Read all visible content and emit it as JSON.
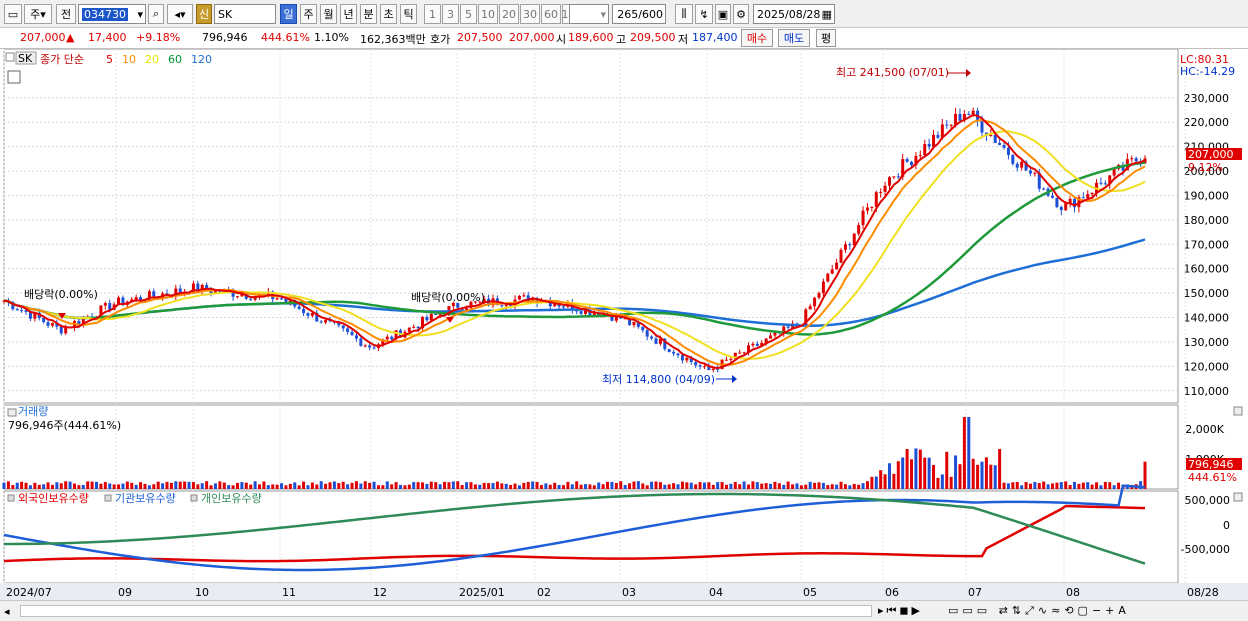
{
  "toolbar": {
    "period_label": "주",
    "prev_label": "전",
    "code": "034730",
    "credit_badge": "신",
    "stock_name": "SK",
    "tabs": [
      "일",
      "주",
      "월",
      "년",
      "분",
      "초",
      "틱"
    ],
    "intervals": [
      "1",
      "3",
      "5",
      "10",
      "20",
      "30",
      "60",
      "120"
    ],
    "count": "265",
    "count_total": "/600",
    "date": "2025/08/28"
  },
  "info": {
    "price": "207,000",
    "change": "17,400",
    "change_pct": "+9.18%",
    "volume": "796,946",
    "volume_pct": "444.61%",
    "turnover": "1.10%",
    "amount": "162,363백만",
    "quote_label": "호가",
    "ask": "207,500",
    "bid": "207,000",
    "open_label": "시",
    "open": "189,600",
    "high_label": "고",
    "high": "209,500",
    "low_label": "저",
    "low": "187,400",
    "buy_button": "매수",
    "sell_button": "매도",
    "extra_button": "평"
  },
  "legend": {
    "name": "SK",
    "ma_label": "종가 단순",
    "ma": [
      {
        "label": "5",
        "color": "#e00000"
      },
      {
        "label": "10",
        "color": "#ff8c00"
      },
      {
        "label": "20",
        "color": "#e6e600"
      },
      {
        "label": "60",
        "color": "#009933"
      },
      {
        "label": "120",
        "color": "#1e6ed8"
      }
    ]
  },
  "annotations": {
    "high": "최고 241,500 (07/01)",
    "low": "최저 114,800 (04/09)",
    "dividend": "배당락(0.00%)"
  },
  "lc_hc": [
    "LC:80.31",
    "HC:-14.29"
  ],
  "price_badge": "207,000",
  "price_badge_pct": "9.12%",
  "volume_panel": {
    "title": "거래량",
    "value": "796,946주(444.61%)",
    "badge": "796,946",
    "badge_pct": "444.61%",
    "ticks": [
      "2,000K",
      "1,000K"
    ]
  },
  "holding_panel": {
    "legend": [
      {
        "label": "외국인보유수량",
        "color": "#e00000"
      },
      {
        "label": "기관보유수량",
        "color": "#1e5fd8"
      },
      {
        "label": "개인보유수량",
        "color": "#2e8b57"
      }
    ],
    "ticks": [
      "500,000",
      "0",
      "-500,000"
    ]
  },
  "x_labels": [
    "2024/07",
    "09",
    "10",
    "11",
    "12",
    "2025/01",
    "02",
    "03",
    "04",
    "05",
    "06",
    "07",
    "08",
    "08/28"
  ],
  "chart_data": {
    "type": "line",
    "y_ticks": [
      230000,
      220000,
      210000,
      200000,
      190000,
      180000,
      170000,
      160000,
      150000,
      140000,
      130000,
      120000,
      110000
    ],
    "ylim": [
      105000,
      250000
    ],
    "price_points": [
      {
        "x": "2024/07",
        "y": 147000
      },
      {
        "x": "2024/08",
        "y": 135000
      },
      {
        "x": "2024/09",
        "y": 146000
      },
      {
        "x": "2024/10",
        "y": 152000
      },
      {
        "x": "2024/11",
        "y": 148000
      },
      {
        "x": "2024/12",
        "y": 128000
      },
      {
        "x": "2025/01",
        "y": 145000
      },
      {
        "x": "2025/02",
        "y": 148000
      },
      {
        "x": "2025/03",
        "y": 140000
      },
      {
        "x": "2025/04",
        "y": 118000
      },
      {
        "x": "2025/05",
        "y": 138000
      },
      {
        "x": "2025/06",
        "y": 195000
      },
      {
        "x": "2025/07",
        "y": 225000
      },
      {
        "x": "2025/08",
        "y": 185000
      },
      {
        "x": "2025/08/28",
        "y": 207000
      }
    ],
    "high": {
      "value": 241500,
      "date": "07/01"
    },
    "low": {
      "value": 114800,
      "date": "04/09"
    }
  }
}
